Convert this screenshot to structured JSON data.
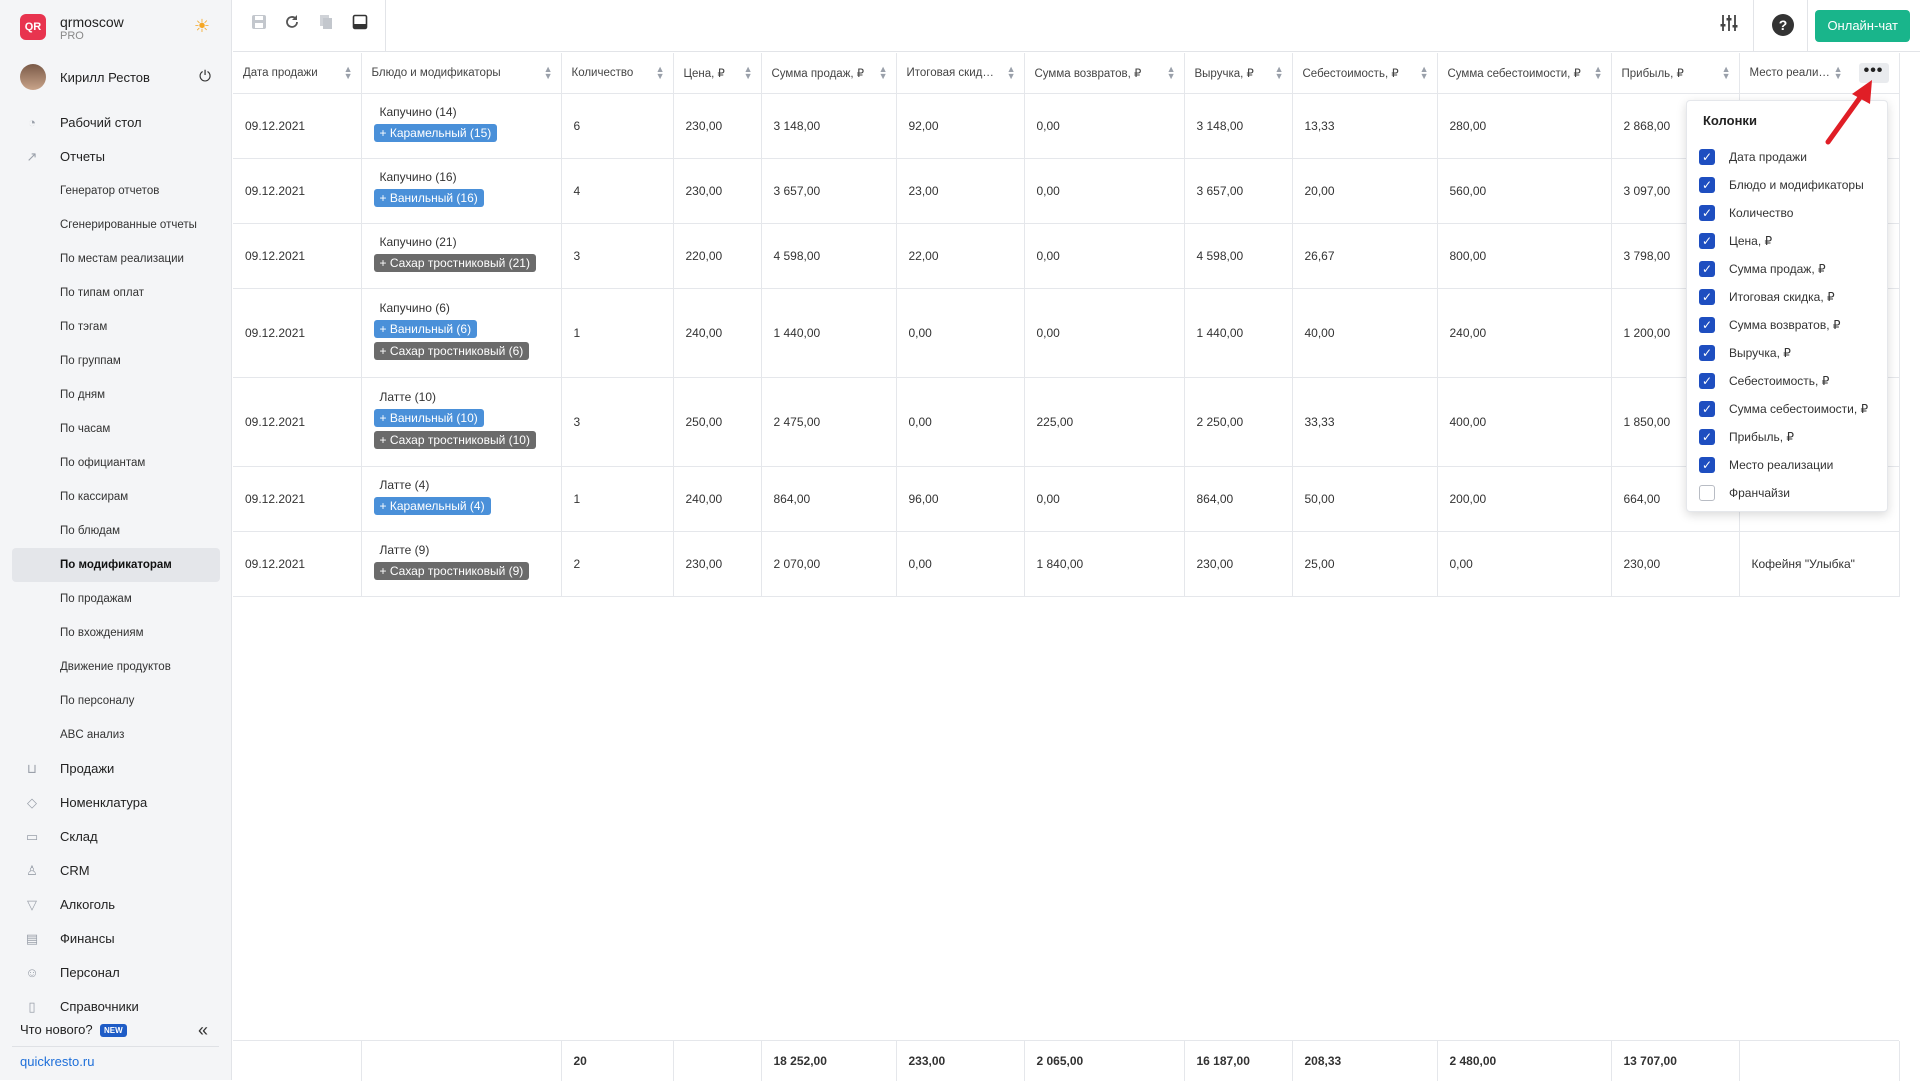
{
  "brand": {
    "name": "qrmoscow",
    "plan": "PRO",
    "logo_text": "QR",
    "theme_icon": "sun-icon"
  },
  "user": {
    "name": "Кирилл Рестов"
  },
  "nav": {
    "top": [
      {
        "label": "Рабочий стол",
        "icon": "dashboard-icon"
      },
      {
        "label": "Отчеты",
        "icon": "chart-icon"
      }
    ],
    "reports": [
      "Генератор отчетов",
      "Сгенерированные отчеты",
      "По местам реализации",
      "По типам оплат",
      "По тэгам",
      "По группам",
      "По дням",
      "По часам",
      "По официантам",
      "По кассирам",
      "По блюдам",
      "По модификаторам",
      "По продажам",
      "По вхождениям",
      "Движение продуктов",
      "По персоналу",
      "ABC анализ"
    ],
    "active_report": "По модификаторам",
    "bottom": [
      {
        "label": "Продажи",
        "icon": "basket-icon"
      },
      {
        "label": "Номенклатура",
        "icon": "tag-icon"
      },
      {
        "label": "Склад",
        "icon": "box-icon"
      },
      {
        "label": "CRM",
        "icon": "people-icon"
      },
      {
        "label": "Алкоголь",
        "icon": "glass-icon"
      },
      {
        "label": "Финансы",
        "icon": "wallet-icon"
      },
      {
        "label": "Персонал",
        "icon": "staff-icon"
      },
      {
        "label": "Справочники",
        "icon": "book-icon"
      }
    ],
    "whats_new": "Что нового?",
    "new_badge": "NEW",
    "site": "quickresto.ru"
  },
  "toolbar": {
    "chat_label": "Онлайн-чат"
  },
  "table": {
    "columns": [
      "Дата продажи",
      "Блюдо и модификаторы",
      "Количество",
      "Цена, ₽",
      "Сумма продаж, ₽",
      "Итоговая скид…",
      "Сумма возвратов, ₽",
      "Выручка, ₽",
      "Себестоимость, ₽",
      "Сумма себестоимости, ₽",
      "Прибыль, ₽",
      "Место реали…"
    ],
    "rows": [
      {
        "date": "09.12.2021",
        "dish": "Капучино (14)",
        "mods": [
          {
            "text": "+ Карамельный (15)",
            "color": "blue"
          }
        ],
        "qty": "6",
        "price": "230,00",
        "sales": "3 148,00",
        "discount": "92,00",
        "returns": "0,00",
        "revenue": "3 148,00",
        "cost": "13,33",
        "cost_sum": "280,00",
        "profit": "2 868,00",
        "place": ""
      },
      {
        "date": "09.12.2021",
        "dish": "Капучино (16)",
        "mods": [
          {
            "text": "+ Ванильный (16)",
            "color": "blue"
          }
        ],
        "qty": "4",
        "price": "230,00",
        "sales": "3 657,00",
        "discount": "23,00",
        "returns": "0,00",
        "revenue": "3 657,00",
        "cost": "20,00",
        "cost_sum": "560,00",
        "profit": "3 097,00",
        "place": ""
      },
      {
        "date": "09.12.2021",
        "dish": "Капучино (21)",
        "mods": [
          {
            "text": "+ Сахар тростниковый (21)",
            "color": "gray"
          }
        ],
        "qty": "3",
        "price": "220,00",
        "sales": "4 598,00",
        "discount": "22,00",
        "returns": "0,00",
        "revenue": "4 598,00",
        "cost": "26,67",
        "cost_sum": "800,00",
        "profit": "3 798,00",
        "place": ""
      },
      {
        "date": "09.12.2021",
        "dish": "Капучино (6)",
        "mods": [
          {
            "text": "+ Ванильный (6)",
            "color": "blue"
          },
          {
            "text": "+ Сахар тростниковый (6)",
            "color": "gray"
          }
        ],
        "qty": "1",
        "price": "240,00",
        "sales": "1 440,00",
        "discount": "0,00",
        "returns": "0,00",
        "revenue": "1 440,00",
        "cost": "40,00",
        "cost_sum": "240,00",
        "profit": "1 200,00",
        "place": ""
      },
      {
        "date": "09.12.2021",
        "dish": "Латте (10)",
        "mods": [
          {
            "text": "+ Ванильный (10)",
            "color": "blue"
          },
          {
            "text": "+ Сахар тростниковый (10)",
            "color": "gray"
          }
        ],
        "qty": "3",
        "price": "250,00",
        "sales": "2 475,00",
        "discount": "0,00",
        "returns": "225,00",
        "revenue": "2 250,00",
        "cost": "33,33",
        "cost_sum": "400,00",
        "profit": "1 850,00",
        "place": ""
      },
      {
        "date": "09.12.2021",
        "dish": "Латте (4)",
        "mods": [
          {
            "text": "+ Карамельный (4)",
            "color": "blue"
          }
        ],
        "qty": "1",
        "price": "240,00",
        "sales": "864,00",
        "discount": "96,00",
        "returns": "0,00",
        "revenue": "864,00",
        "cost": "50,00",
        "cost_sum": "200,00",
        "profit": "664,00",
        "place": ""
      },
      {
        "date": "09.12.2021",
        "dish": "Латте (9)",
        "mods": [
          {
            "text": "+ Сахар тростниковый (9)",
            "color": "gray"
          }
        ],
        "qty": "2",
        "price": "230,00",
        "sales": "2 070,00",
        "discount": "0,00",
        "returns": "1 840,00",
        "revenue": "230,00",
        "cost": "25,00",
        "cost_sum": "0,00",
        "profit": "230,00",
        "place": "Кофейня \"Улыбка\""
      }
    ],
    "totals": {
      "qty": "20",
      "sales": "18 252,00",
      "discount": "233,00",
      "returns": "2 065,00",
      "revenue": "16 187,00",
      "cost": "208,33",
      "cost_sum": "2 480,00",
      "profit": "13 707,00"
    }
  },
  "columns_popup": {
    "title": "Колонки",
    "options": [
      {
        "label": "Дата продажи",
        "checked": true
      },
      {
        "label": "Блюдо и модификаторы",
        "checked": true
      },
      {
        "label": "Количество",
        "checked": true
      },
      {
        "label": "Цена, ₽",
        "checked": true
      },
      {
        "label": "Сумма продаж, ₽",
        "checked": true
      },
      {
        "label": "Итоговая скидка, ₽",
        "checked": true
      },
      {
        "label": "Сумма возвратов, ₽",
        "checked": true
      },
      {
        "label": "Выручка, ₽",
        "checked": true
      },
      {
        "label": "Себестоимость, ₽",
        "checked": true
      },
      {
        "label": "Сумма себестоимости, ₽",
        "checked": true
      },
      {
        "label": "Прибыль, ₽",
        "checked": true
      },
      {
        "label": "Место реализации",
        "checked": true
      },
      {
        "label": "Франчайзи",
        "checked": false
      }
    ]
  },
  "colors": {
    "accent": "#1e4ec0",
    "chat": "#19b58b",
    "mod_blue": "#4a90d9",
    "mod_gray": "#6b6b6b",
    "arrow": "#e01e26"
  }
}
